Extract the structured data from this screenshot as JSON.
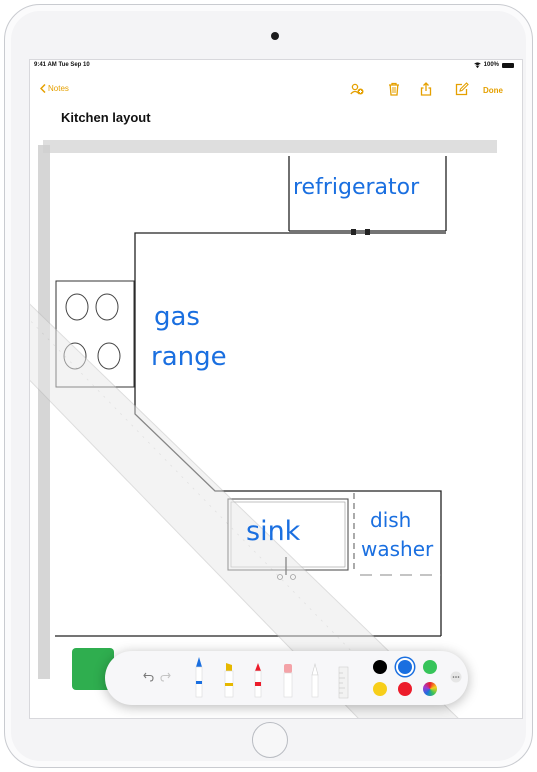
{
  "status_bar": {
    "time": "9:41 AM  Tue Sep 10",
    "battery": "100%"
  },
  "nav": {
    "back_label": "Notes",
    "done_label": "Done",
    "toolbar_icons": [
      "people-add-icon",
      "trash-icon",
      "share-icon",
      "compose-icon"
    ]
  },
  "note": {
    "title": "Kitchen layout",
    "drawing_labels": {
      "refrigerator": "refrigerator",
      "gas": "gas",
      "range": "range",
      "sink": "sink",
      "dish": "dish",
      "washer": "washer"
    }
  },
  "markup_toolbar": {
    "tools": [
      "undo-icon",
      "redo-icon",
      "pen-tool",
      "marker-tool",
      "pencil-tool",
      "eraser-tool",
      "lasso-tool",
      "ruler-tool",
      "more-icon"
    ],
    "colors": [
      "#000000",
      "#1a6fe0",
      "#37c45a",
      "#f7ce1a",
      "#ec1c2b",
      "multicolor"
    ],
    "selected_color": "#1a6fe0",
    "accent": "#e5a000"
  }
}
